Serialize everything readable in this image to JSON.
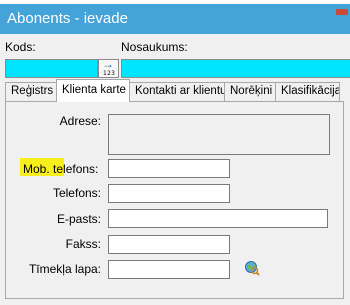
{
  "window": {
    "title": "Abonents - ievade"
  },
  "header": {
    "kods_label": "Kods:",
    "nosaukums_label": "Nosaukums:",
    "kods_value": "",
    "nosaukums_value": "",
    "counter_digits": "123"
  },
  "tabs": [
    {
      "label": "Reģistrs",
      "active": false
    },
    {
      "label": "Klienta karte",
      "active": true
    },
    {
      "label": "Kontakti ar klientu",
      "active": false
    },
    {
      "label": "Norēķini",
      "active": false
    },
    {
      "label": "Klasifikācija",
      "active": false
    }
  ],
  "form": {
    "adrese_label": "Adrese:",
    "adrese_value": "",
    "mob_label_highlighted": "Mob.",
    "mob_label_rest": " telefons:",
    "mob_value": "",
    "telefons_label": "Telefons:",
    "telefons_value": "",
    "epasts_label": "E-pasts:",
    "epasts_value": "",
    "fakss_label": "Fakss:",
    "fakss_value": "",
    "timekla_label": "Tīmekļa lapa:",
    "timekla_value": ""
  },
  "icons": {
    "web_lookup": "globe-search-icon"
  },
  "colors": {
    "title_bar": "#44a3d8",
    "key_field": "#00e5ff",
    "highlight": "#f7ee1c",
    "close_button": "#c84b3a"
  }
}
